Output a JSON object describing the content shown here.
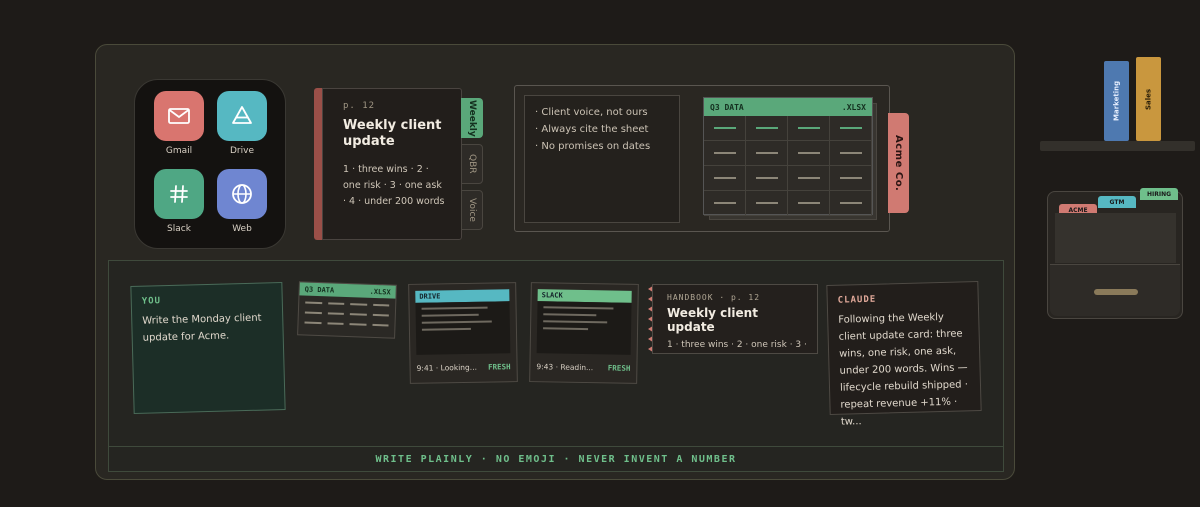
{
  "launcher": {
    "apps": [
      {
        "label": "Gmail",
        "icon": "mail-icon",
        "color": "#d9756f"
      },
      {
        "label": "Drive",
        "icon": "drive-icon",
        "color": "#56b8c2"
      },
      {
        "label": "Slack",
        "icon": "hash-icon",
        "color": "#4fa784"
      },
      {
        "label": "Web",
        "icon": "globe-icon",
        "color": "#6f86d1"
      }
    ]
  },
  "handbook": {
    "page": "p. 12",
    "title": "Weekly client update",
    "body": "1 · three wins · 2 · one risk · 3 · one ask · 4 · under 200 words",
    "tabs": [
      "Weekly",
      "QBR",
      "Voice"
    ]
  },
  "book": {
    "rules": [
      "· Client voice, not ours",
      "· Always cite the sheet",
      "· No promises on dates"
    ],
    "sheet_title": "Q3 DATA",
    "sheet_ext": ".XLSX",
    "client_tab": "Acme Co."
  },
  "shelf": {
    "books": [
      "Marketing",
      "Sales"
    ]
  },
  "cabinet": {
    "tabs": [
      "ACME",
      "GTM",
      "HIRING"
    ]
  },
  "tray": {
    "you": {
      "who": "YOU",
      "text": "Write the Monday client update for Acme."
    },
    "sheet": {
      "title": "Q3 DATA",
      "ext": ".XLSX"
    },
    "drive": {
      "label": "DRIVE",
      "time": "9:41 · Looking...",
      "status": "FRESH"
    },
    "slack": {
      "label": "SLACK",
      "time": "9:43 · Readin...",
      "status": "FRESH"
    },
    "handbook": {
      "page": "HANDBOOK · p. 12",
      "title": "Weekly client update",
      "body": "1 · three wins · 2 · one risk · 3 · o..."
    },
    "claude": {
      "who": "CLAUDE",
      "text": "Following the Weekly client update card: three wins, one risk, one ask, under 200 words. Wins — lifecycle rebuild shipped · repeat revenue +11% · tw..."
    },
    "footer": "WRITE PLAINLY · NO EMOJI · NEVER INVENT A NUMBER"
  }
}
